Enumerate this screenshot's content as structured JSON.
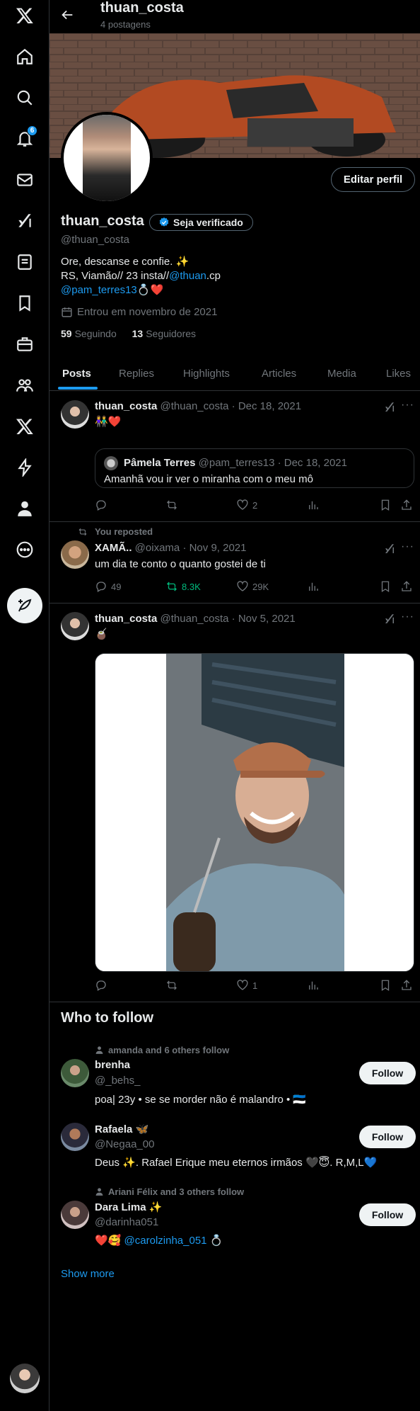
{
  "colors": {
    "accent": "#1d9bf0",
    "retweet_green": "#00ba7c",
    "background": "#000000",
    "border": "#2f3336",
    "muted": "#71767b"
  },
  "sidebar": {
    "notification_count": "6",
    "items": [
      {
        "icon": "x-logo-icon"
      },
      {
        "icon": "home-icon"
      },
      {
        "icon": "search-icon"
      },
      {
        "icon": "bell-icon"
      },
      {
        "icon": "mail-icon"
      },
      {
        "icon": "grok-icon"
      },
      {
        "icon": "lists-icon"
      },
      {
        "icon": "bookmark-icon"
      },
      {
        "icon": "jobs-icon"
      },
      {
        "icon": "communities-icon"
      },
      {
        "icon": "premium-x-icon"
      },
      {
        "icon": "verified-orgs-icon"
      },
      {
        "icon": "profile-icon"
      },
      {
        "icon": "more-icon"
      },
      {
        "icon": "post-compose-icon"
      }
    ]
  },
  "header": {
    "name": "thuan_costa",
    "post_count": "4 postagens"
  },
  "profile": {
    "display_name": "thuan_costa",
    "verify_label": "Seja verificado",
    "handle": "@thuan_costa",
    "edit_label": "Editar perfil",
    "bio_line1": "Ore, descanse e confie. ✨",
    "bio_line2_prefix": "RS, Viamão// 23 insta//",
    "bio_line2_link": "@thuan",
    "bio_line2_suffix": ".cp",
    "bio_line3_link": "@pam_terres13",
    "bio_line3_suffix": "💍❤️",
    "joined": "Entrou em novembro de 2021",
    "following_count": "59",
    "following_label": "Seguindo",
    "followers_count": "13",
    "followers_label": "Seguidores"
  },
  "tabs": [
    "Posts",
    "Replies",
    "Highlights",
    "Articles",
    "Media",
    "Likes"
  ],
  "tweets": [
    {
      "name": "thuan_costa",
      "handle": "@thuan_costa",
      "date": "· Dec 18, 2021",
      "text": "👫❤️",
      "quote": {
        "name": "Pâmela Terres",
        "handle": "@pam_terres13",
        "date": "· Dec 18, 2021",
        "text": "Amanhã vou ir ver o miranha com o meu mô"
      },
      "replies": "",
      "reposts": "",
      "likes": "2"
    },
    {
      "context": "You reposted",
      "name": "XAMÃ..",
      "handle": "@oixama",
      "date": "· Nov 9, 2021",
      "text": "um dia te conto o quanto gostei de ti",
      "replies": "49",
      "reposts": "8.3K",
      "likes": "29K"
    },
    {
      "name": "thuan_costa",
      "handle": "@thuan_costa",
      "date": "· Nov 5, 2021",
      "text": "🧉",
      "replies": "",
      "reposts": "",
      "likes": "1"
    }
  ],
  "who_to_follow": {
    "title": "Who to follow",
    "follow_label": "Follow",
    "show_more": "Show more",
    "suggestions": [
      {
        "context": "amanda and 6 others follow",
        "name": "brenha",
        "handle": "@_behs_",
        "bio": "poa| 23y • se se morder não é malandro • 🇪🇪"
      },
      {
        "context": "",
        "name": "Rafaela 🦋",
        "handle": "@Negaa_00",
        "bio": "Deus ✨. Rafael Erique meu eternos irmãos 🖤😇. R,M,L💙"
      },
      {
        "context": "Ariani Félix and 3 others follow",
        "name": "Dara Lima ✨",
        "handle": "@darinha051",
        "bio_prefix": "❤️🥰 ",
        "bio_link": "@carolzinha_051",
        "bio_suffix": " 💍"
      }
    ]
  }
}
